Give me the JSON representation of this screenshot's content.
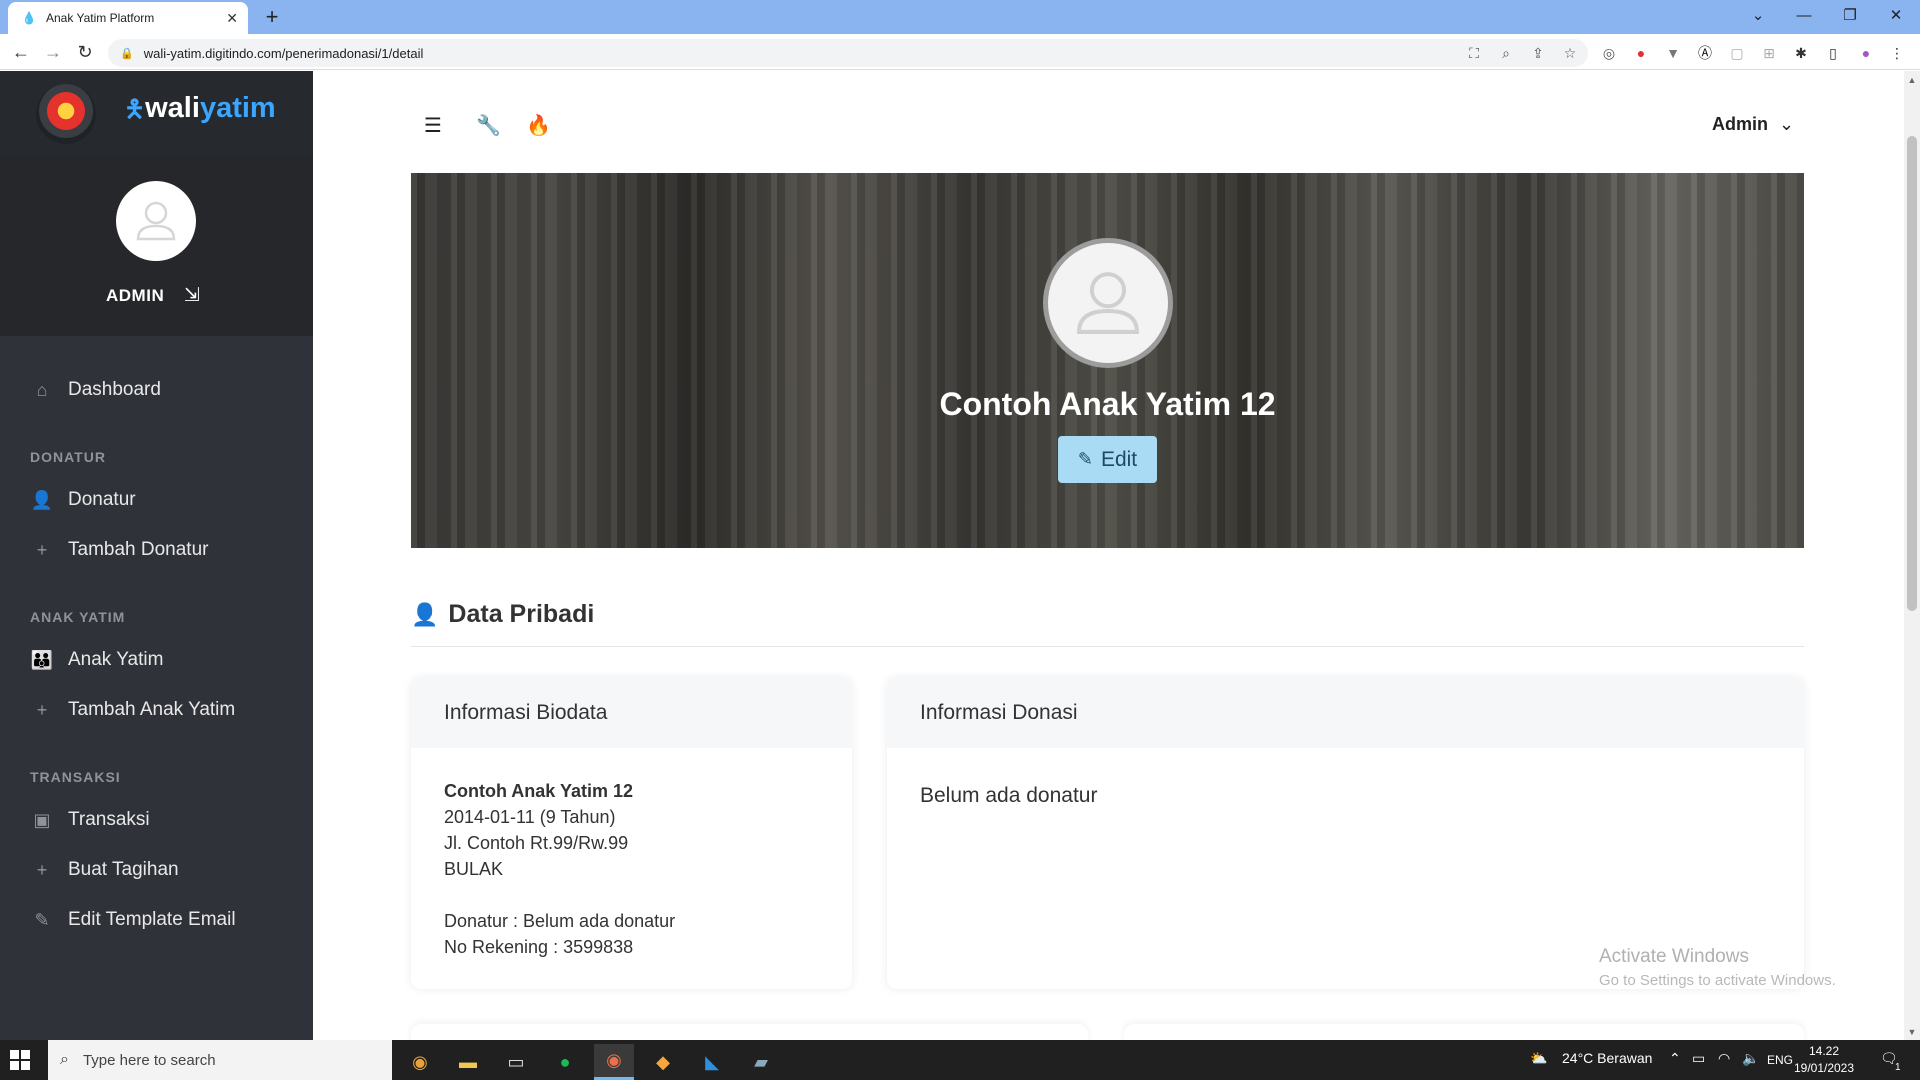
{
  "browser": {
    "tab_title": "Anak Yatim Platform",
    "new_tab": "+",
    "url": "wali-yatim.digitindo.com/penerimadonasi/1/detail",
    "window_controls": [
      "⌄",
      "—",
      "❐",
      "✕"
    ]
  },
  "brand": {
    "name_part1": "wali",
    "name_part2": "yatim"
  },
  "sidebar": {
    "user_name": "ADMIN",
    "items": [
      {
        "label": "Dashboard",
        "icon": "home-icon"
      },
      {
        "label": "Donatur",
        "icon": "user-icon"
      },
      {
        "label": "Tambah Donatur",
        "icon": "plus-icon"
      },
      {
        "label": "Anak Yatim",
        "icon": "children-icon"
      },
      {
        "label": "Tambah Anak Yatim",
        "icon": "plus-icon"
      },
      {
        "label": "Transaksi",
        "icon": "money-icon"
      },
      {
        "label": "Buat Tagihan",
        "icon": "plus-icon"
      },
      {
        "label": "Edit Template Email",
        "icon": "pencil-icon"
      }
    ],
    "headings": [
      "DONATUR",
      "ANAK YATIM",
      "TRANSAKSI"
    ]
  },
  "header": {
    "admin_menu": "Admin"
  },
  "profile": {
    "name": "Contoh Anak Yatim 12",
    "edit_label": "Edit"
  },
  "section": {
    "title": "Data Pribadi"
  },
  "biodata": {
    "title": "Informasi Biodata",
    "name": "Contoh Anak Yatim 12",
    "birth": "2014-01-11 (9 Tahun)",
    "address": "Jl. Contoh Rt.99/Rw.99",
    "village": "BULAK",
    "donor": "Donatur : Belum ada donatur",
    "account": "No Rekening : 3599838"
  },
  "donasi": {
    "title": "Informasi Donasi",
    "status": "Belum ada donatur"
  },
  "watermark": {
    "line1": "Activate Windows",
    "line2": "Go to Settings to activate Windows."
  },
  "taskbar": {
    "search_placeholder": "Type here to search",
    "weather": "24°C  Berawan",
    "lang": "ENG",
    "time": "14.22",
    "date": "19/01/2023",
    "notif_count": "1"
  },
  "colors": {
    "sidebar_bg": "#2f3238",
    "brand_accent": "#3aa6ff",
    "edit_button": "#a9dbf5"
  }
}
